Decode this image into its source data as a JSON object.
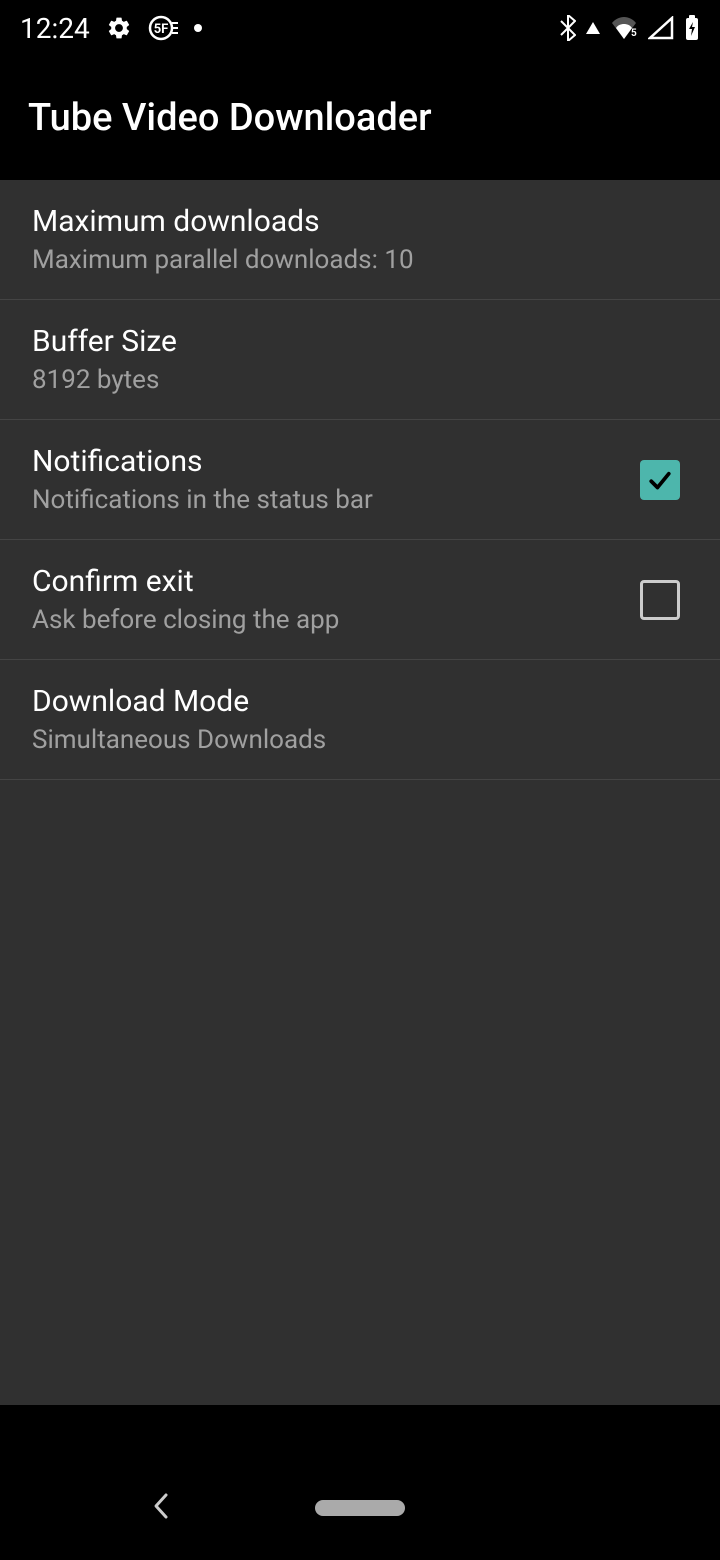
{
  "status": {
    "time": "12:24"
  },
  "header": {
    "title": "Tube Video Downloader"
  },
  "settings": {
    "maxDownloads": {
      "title": "Maximum downloads",
      "subtitle": "Maximum parallel downloads: 10"
    },
    "bufferSize": {
      "title": "Buffer Size",
      "subtitle": "8192 bytes"
    },
    "notifications": {
      "title": "Notifications",
      "subtitle": "Notifications in the status bar",
      "checked": true
    },
    "confirmExit": {
      "title": "Confirm exit",
      "subtitle": "Ask before closing the app",
      "checked": false
    },
    "downloadMode": {
      "title": "Download Mode",
      "subtitle": "Simultaneous Downloads"
    }
  }
}
